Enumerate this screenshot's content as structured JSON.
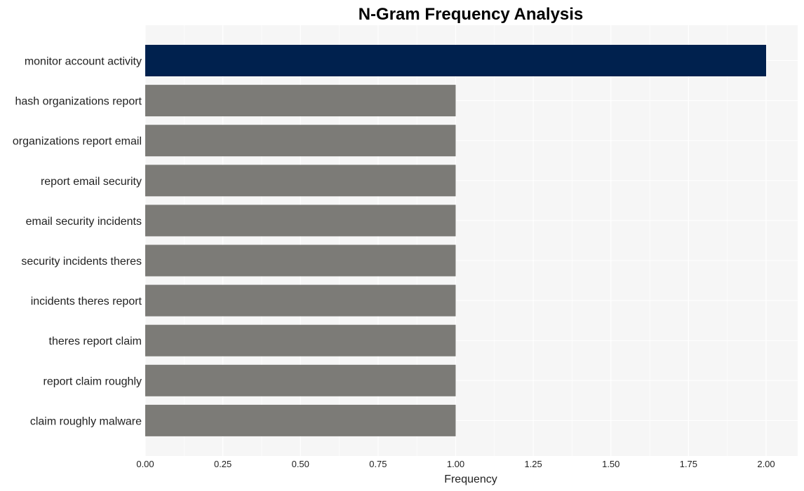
{
  "chart_data": {
    "type": "bar",
    "orientation": "horizontal",
    "title": "N-Gram Frequency Analysis",
    "xlabel": "Frequency",
    "ylabel": "",
    "xlim": [
      0,
      2.1
    ],
    "xticks": [
      "0.00",
      "0.25",
      "0.50",
      "0.75",
      "1.00",
      "1.25",
      "1.50",
      "1.75",
      "2.00"
    ],
    "grid": true,
    "categories": [
      "monitor account activity",
      "hash organizations report",
      "organizations report email",
      "report email security",
      "email security incidents",
      "security incidents theres",
      "incidents theres report",
      "theres report claim",
      "report claim roughly",
      "claim roughly malware"
    ],
    "values": [
      2,
      1,
      1,
      1,
      1,
      1,
      1,
      1,
      1,
      1
    ],
    "colors": {
      "highlight": "#00214e",
      "default": "#7c7b77",
      "plot_background": "#f6f6f6",
      "grid": "#ffffff"
    }
  }
}
